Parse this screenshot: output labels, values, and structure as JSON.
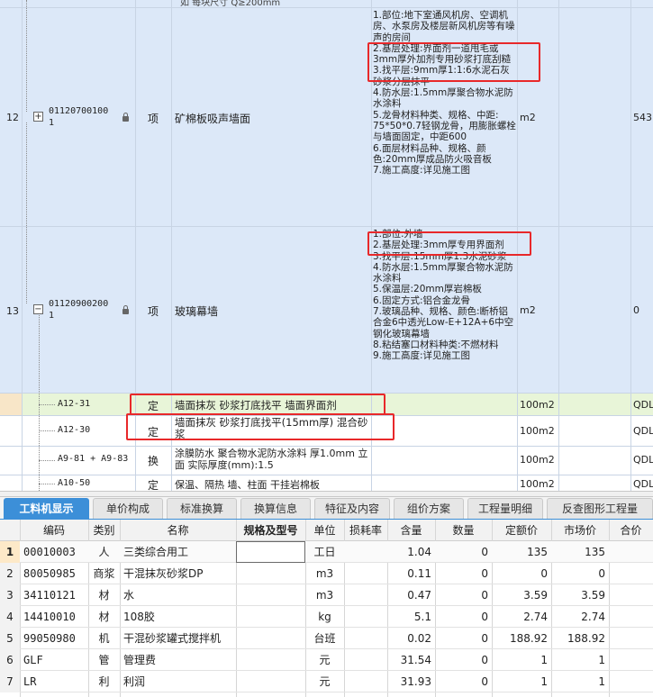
{
  "top_cut_text": "如 每块尺寸 Q≥200mm",
  "rows": [
    {
      "index": "12",
      "code": "01120700100\n1",
      "type": "项",
      "name": "矿棉板吸声墙面",
      "unit": "m2",
      "qty": "543.",
      "description": "1.部位:地下室通风机房、空调机房、水泵房及楼层新风机房等有噪声的房间\n2.基层处理:界面剂一道甩毛或3mm厚外加剂专用砂浆打底刮糙\n3.找平层:9mm厚1:1:6水泥石灰砂浆分层抹平\n4.防水层:1.5mm厚聚合物水泥防水涂料\n5.龙骨材料种类、规格、中距: 75*50*0.7轻钢龙骨，用膨胀螺栓与墙面固定，中距600\n6.面层材料品种、规格、颜色:20mm厚成品防火吸音板\n7.施工高度:详见施工图"
    },
    {
      "index": "13",
      "code": "01120900200\n1",
      "type": "项",
      "name": "玻璃幕墙",
      "unit": "m2",
      "qty": "0",
      "description": "1.部位:外墙\n2.基层处理:3mm厚专用界面剂\n3.找平层:15mm厚1:3水泥砂浆\n4.防水层:1.5mm厚聚合物水泥防水涂料\n5.保温层:20mm厚岩棉板\n6.固定方式:铝合金龙骨\n7.玻璃品种、规格、颜色:断桥铝合金6中透光Low-E+12A+6中空钢化玻璃幕墙\n8.粘结塞口材料种类:不燃材料\n9.施工高度:详见施工图"
    }
  ],
  "sub_rows": [
    {
      "code": "A12-31",
      "type": "定",
      "name": "墙面抹灰 砂浆打底找平 墙面界面剂",
      "unit": "100m2",
      "tail": "QDL"
    },
    {
      "code": "A12-30",
      "type": "定",
      "name": "墙面抹灰 砂浆打底找平(15mm厚) 混合砂浆",
      "unit": "100m2",
      "tail": "QDL"
    },
    {
      "code": "A9-81 + A9-83",
      "type": "换",
      "name": "涂膜防水 聚合物水泥防水涂料 厚1.0mm 立面  实际厚度(mm):1.5",
      "unit": "100m2",
      "tail": "QDL"
    },
    {
      "code": "A10-50",
      "type": "定",
      "name": "保温、隔热 墙、柱面 干挂岩棉板",
      "unit": "100m2",
      "tail": "QDL"
    }
  ],
  "tabs": [
    "工料机显示",
    "单价构成",
    "标准换算",
    "换算信息",
    "特征及内容",
    "组价方案",
    "工程量明细",
    "反查图形工程量"
  ],
  "bottom_table": {
    "headers": [
      "编码",
      "类别",
      "名称",
      "规格及型号",
      "单位",
      "损耗率",
      "含量",
      "数量",
      "定额价",
      "市场价",
      "合价"
    ],
    "rows": [
      {
        "n": "1",
        "code": "00010003",
        "cat": "人",
        "name": "三类综合用工",
        "spec": "",
        "unit": "工日",
        "loss": "",
        "content": "1.04",
        "qty": "0",
        "quota": "135",
        "market": "135",
        "total": ""
      },
      {
        "n": "2",
        "code": "80050985",
        "cat": "商浆",
        "name": "干混抹灰砂浆DP",
        "spec": "",
        "unit": "m3",
        "loss": "",
        "content": "0.11",
        "qty": "0",
        "quota": "0",
        "market": "0",
        "total": ""
      },
      {
        "n": "3",
        "code": "34110121",
        "cat": "材",
        "name": "水",
        "spec": "",
        "unit": "m3",
        "loss": "",
        "content": "0.47",
        "qty": "0",
        "quota": "3.59",
        "market": "3.59",
        "total": ""
      },
      {
        "n": "4",
        "code": "14410010",
        "cat": "材",
        "name": "108胶",
        "spec": "",
        "unit": "kg",
        "loss": "",
        "content": "5.1",
        "qty": "0",
        "quota": "2.74",
        "market": "2.74",
        "total": ""
      },
      {
        "n": "5",
        "code": "99050980",
        "cat": "机",
        "name": "干混砂浆罐式搅拌机",
        "spec": "",
        "unit": "台班",
        "loss": "",
        "content": "0.02",
        "qty": "0",
        "quota": "188.92",
        "market": "188.92",
        "total": ""
      },
      {
        "n": "6",
        "code": "GLF",
        "cat": "管",
        "name": "管理费",
        "spec": "",
        "unit": "元",
        "loss": "",
        "content": "31.54",
        "qty": "0",
        "quota": "1",
        "market": "1",
        "total": ""
      },
      {
        "n": "7",
        "code": "LR",
        "cat": "利",
        "name": "利润",
        "spec": "",
        "unit": "元",
        "loss": "",
        "content": "31.93",
        "qty": "0",
        "quota": "1",
        "market": "1",
        "total": ""
      }
    ]
  },
  "colors": {
    "row_bg": "#dce8f8",
    "selected_bg": "#e8f5d8",
    "tab_active": "#3c8fd8",
    "highlight": "#e8282a"
  }
}
